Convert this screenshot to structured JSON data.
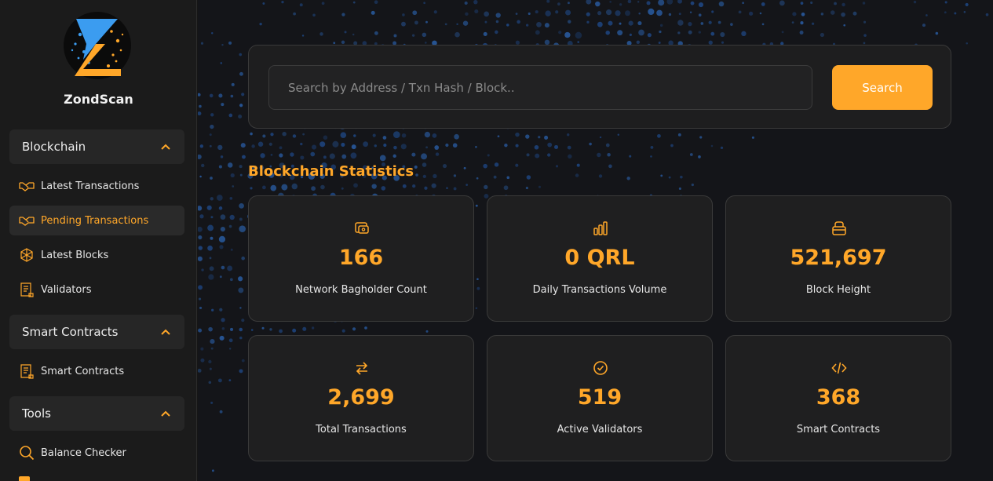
{
  "app": {
    "brand_name": "ZondScan",
    "accent_color": "#ffa729",
    "logo_icon": "zond-logo"
  },
  "sidebar": {
    "sections": [
      {
        "title": "Blockchain",
        "expanded": true,
        "items": [
          {
            "label": "Latest Transactions",
            "icon": "handshake-icon"
          },
          {
            "label": "Pending Transactions",
            "icon": "handshake-icon",
            "active": true
          },
          {
            "label": "Latest Blocks",
            "icon": "cube-network-icon"
          },
          {
            "label": "Validators",
            "icon": "receipt-icon"
          }
        ]
      },
      {
        "title": "Smart Contracts",
        "expanded": true,
        "items": [
          {
            "label": "Smart Contracts",
            "icon": "receipt-icon"
          }
        ]
      },
      {
        "title": "Tools",
        "expanded": true,
        "items": [
          {
            "label": "Balance Checker",
            "icon": "magnifier-icon"
          }
        ]
      }
    ]
  },
  "search": {
    "placeholder": "Search by Address / Txn Hash / Block..",
    "value": "",
    "button_label": "Search"
  },
  "stats": {
    "title": "Blockchain Statistics",
    "cards": [
      {
        "value": "166",
        "label": "Network Bagholder Count",
        "icon": "wallet-icon"
      },
      {
        "value": "0 QRL",
        "label": "Daily Transactions Volume",
        "icon": "bar-chart-icon"
      },
      {
        "value": "521,697",
        "label": "Block Height",
        "icon": "box-icon"
      },
      {
        "value": "2,699",
        "label": "Total Transactions",
        "icon": "arrows-exchange-icon"
      },
      {
        "value": "519",
        "label": "Active Validators",
        "icon": "check-circle-icon"
      },
      {
        "value": "368",
        "label": "Smart Contracts",
        "icon": "code-icon"
      }
    ]
  }
}
